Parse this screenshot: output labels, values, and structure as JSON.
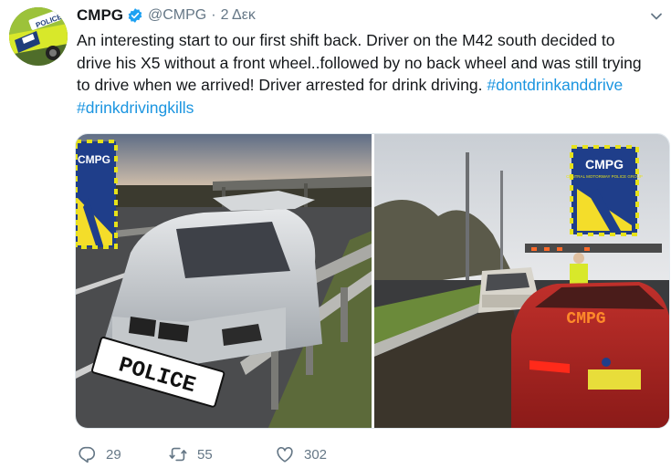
{
  "tweet": {
    "avatar": {
      "icon": "police-car-avatar",
      "badge_text": "POLICE"
    },
    "author_name": "CMPG",
    "verified_icon": "verified-badge-icon",
    "handle": "@CMPG",
    "separator": "·",
    "timestamp": "2 Δεκ",
    "menu_icon": "chevron-down-icon",
    "text_lines": [
      "An interesting start to our first shift back. Driver on the M42 south decided to",
      "drive his X5 without a front wheel..followed by no back wheel and was still trying",
      "to drive when we arrived! Driver arrested for drink driving."
    ],
    "hashtags": [
      "#dontdrinkanddrive",
      "#drinkdrivingkills"
    ],
    "media": {
      "left_photo": {
        "description_icon": "crashed-bmw-photo",
        "plate_text": "POLICE",
        "logo_text": "CMPG",
        "logo_subtext": "CENTRAL MOTORWAY POLICE GROUP"
      },
      "right_photo": {
        "description_icon": "police-car-behind-bmw-photo",
        "rear_display_text": "CMPG",
        "logo_text": "CMPG",
        "logo_subtext": "CENTRAL MOTORWAY POLICE GROUP"
      }
    },
    "actions": {
      "reply_count": "29",
      "retweet_count": "55",
      "like_count": "302"
    }
  },
  "colors": {
    "link": "#1b95e0",
    "muted": "#657786",
    "text": "#14171a",
    "verified": "#1da1f2"
  }
}
